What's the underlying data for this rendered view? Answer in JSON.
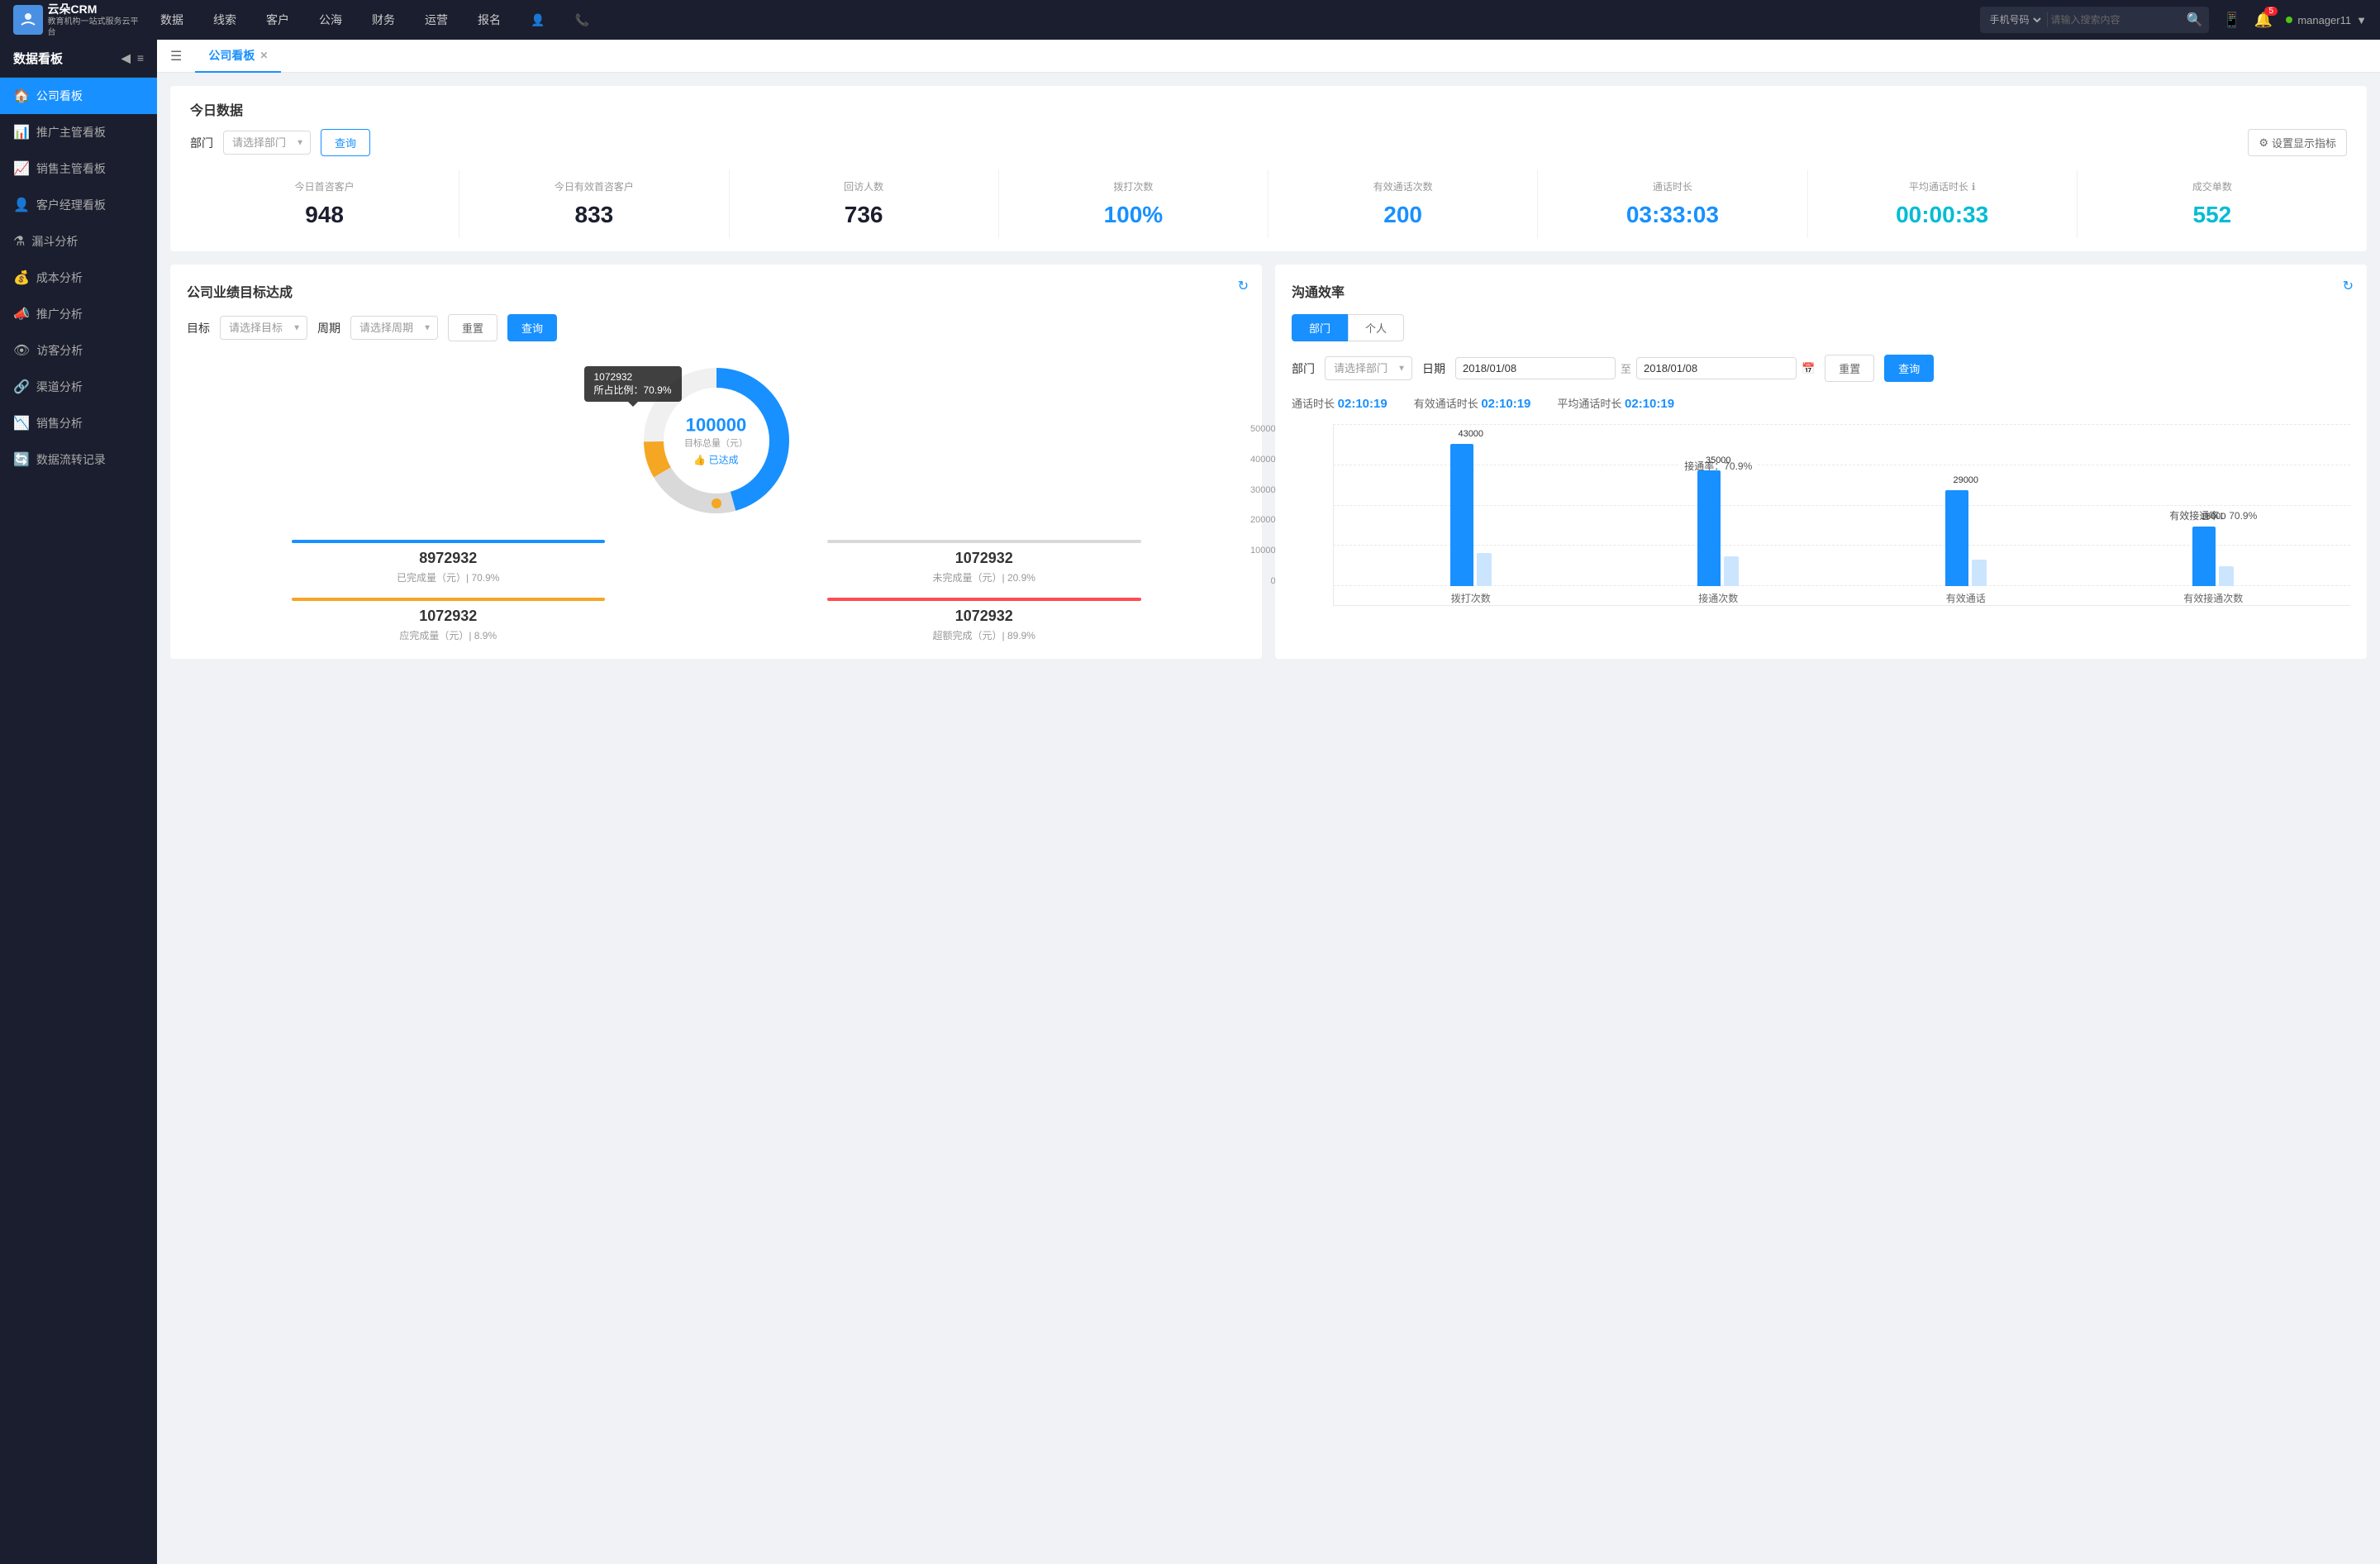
{
  "topNav": {
    "logo": {
      "line1": "云朵CRM",
      "line2": "教育机构一站式服务云平台"
    },
    "navItems": [
      "数据",
      "线索",
      "客户",
      "公海",
      "财务",
      "运营",
      "报名"
    ],
    "search": {
      "placeholder": "请输入搜索内容",
      "selectLabel": "手机号码"
    },
    "notifications": "5",
    "username": "manager11"
  },
  "sidebar": {
    "title": "数据看板",
    "items": [
      {
        "label": "公司看板",
        "icon": "🏠",
        "active": true
      },
      {
        "label": "推广主管看板",
        "icon": "📊",
        "active": false
      },
      {
        "label": "销售主管看板",
        "icon": "📈",
        "active": false
      },
      {
        "label": "客户经理看板",
        "icon": "👤",
        "active": false
      },
      {
        "label": "漏斗分析",
        "icon": "⚗",
        "active": false
      },
      {
        "label": "成本分析",
        "icon": "💰",
        "active": false
      },
      {
        "label": "推广分析",
        "icon": "📣",
        "active": false
      },
      {
        "label": "访客分析",
        "icon": "👁",
        "active": false
      },
      {
        "label": "渠道分析",
        "icon": "🔗",
        "active": false
      },
      {
        "label": "销售分析",
        "icon": "📉",
        "active": false
      },
      {
        "label": "数据流转记录",
        "icon": "🔄",
        "active": false
      }
    ]
  },
  "tabs": [
    {
      "label": "公司看板",
      "active": true
    }
  ],
  "todaySection": {
    "title": "今日数据",
    "filterLabel": "部门",
    "filterPlaceholder": "请选择部门",
    "queryBtn": "查询",
    "settingsBtn": "设置显示指标",
    "stats": [
      {
        "label": "今日首咨客户",
        "value": "948",
        "colorClass": "dark"
      },
      {
        "label": "今日有效首咨客户",
        "value": "833",
        "colorClass": "dark"
      },
      {
        "label": "回访人数",
        "value": "736",
        "colorClass": "dark"
      },
      {
        "label": "拨打次数",
        "value": "100%",
        "colorClass": "blue"
      },
      {
        "label": "有效通话次数",
        "value": "200",
        "colorClass": "blue"
      },
      {
        "label": "通话时长",
        "value": "03:33:03",
        "colorClass": "blue"
      },
      {
        "label": "平均通话时长",
        "value": "00:00:33",
        "colorClass": "cyan"
      },
      {
        "label": "成交单数",
        "value": "552",
        "colorClass": "cyan"
      }
    ]
  },
  "goalSection": {
    "title": "公司业绩目标达成",
    "goalLabel": "目标",
    "goalPlaceholder": "请选择目标",
    "periodLabel": "周期",
    "periodPlaceholder": "请选择周期",
    "resetBtn": "重置",
    "queryBtn": "查询",
    "chart": {
      "centerValue": "100000",
      "centerLabel": "目标总量（元）",
      "achievedLabel": "👍 已达成",
      "tooltip": {
        "value": "1072932",
        "ratio": "所占比例：70.9%"
      },
      "donutData": [
        {
          "percent": 70.9,
          "color": "#1890ff"
        },
        {
          "percent": 20.9,
          "color": "#e8e8e8"
        },
        {
          "percent": 8.2,
          "color": "#f5a623"
        }
      ]
    },
    "statsBottom": [
      {
        "value": "8972932",
        "label": "已完成量（元）| 70.9%",
        "barColor": "#1890ff"
      },
      {
        "value": "1072932",
        "label": "未完成量（元）| 20.9%",
        "barColor": "#d9d9d9"
      },
      {
        "value": "1072932",
        "label": "应完成量（元）| 8.9%",
        "barColor": "#f5a623"
      },
      {
        "value": "1072932",
        "label": "超额完成（元）| 89.9%",
        "barColor": "#ff4d4f"
      }
    ]
  },
  "efficiencySection": {
    "title": "沟通效率",
    "tabBtns": [
      "部门",
      "个人"
    ],
    "activeTab": "部门",
    "deptLabel": "部门",
    "deptPlaceholder": "请选择部门",
    "dateLabel": "日期",
    "dateFrom": "2018/01/08",
    "dateTo": "2018/01/08",
    "resetBtn": "重置",
    "queryBtn": "查询",
    "statsRow": {
      "talkTime": "通话时长",
      "talkTimeValue": "02:10:19",
      "effectiveTalkTime": "有效通话时长",
      "effectiveTalkTimeValue": "02:10:19",
      "avgTalkTime": "平均通话时长",
      "avgTalkTimeValue": "02:10:19"
    },
    "chart": {
      "yLabels": [
        "50000",
        "40000",
        "30000",
        "20000",
        "10000",
        "0"
      ],
      "groups": [
        {
          "xLabel": "拨打次数",
          "bars": [
            {
              "value": 43000,
              "height": 172,
              "color": "#1890ff",
              "label": "43000"
            },
            {
              "value": 9000,
              "height": 36,
              "color": "#d0e8ff",
              "label": ""
            }
          ],
          "rateLabel": ""
        },
        {
          "xLabel": "接通次数",
          "bars": [
            {
              "value": 35000,
              "height": 140,
              "color": "#1890ff",
              "label": "35000"
            },
            {
              "value": 8000,
              "height": 32,
              "color": "#d0e8ff",
              "label": ""
            }
          ],
          "rateLabel": "接通率：70.9%"
        },
        {
          "xLabel": "有效通话",
          "bars": [
            {
              "value": 29000,
              "height": 116,
              "color": "#1890ff",
              "label": "29000"
            },
            {
              "value": 7000,
              "height": 28,
              "color": "#d0e8ff",
              "label": ""
            }
          ],
          "rateLabel": ""
        },
        {
          "xLabel": "有效接通次数",
          "bars": [
            {
              "value": 18000,
              "height": 72,
              "color": "#1890ff",
              "label": "18000"
            },
            {
              "value": 6000,
              "height": 24,
              "color": "#d0e8ff",
              "label": ""
            }
          ],
          "rateLabel": "有效接通率：70.9%"
        }
      ]
    }
  }
}
